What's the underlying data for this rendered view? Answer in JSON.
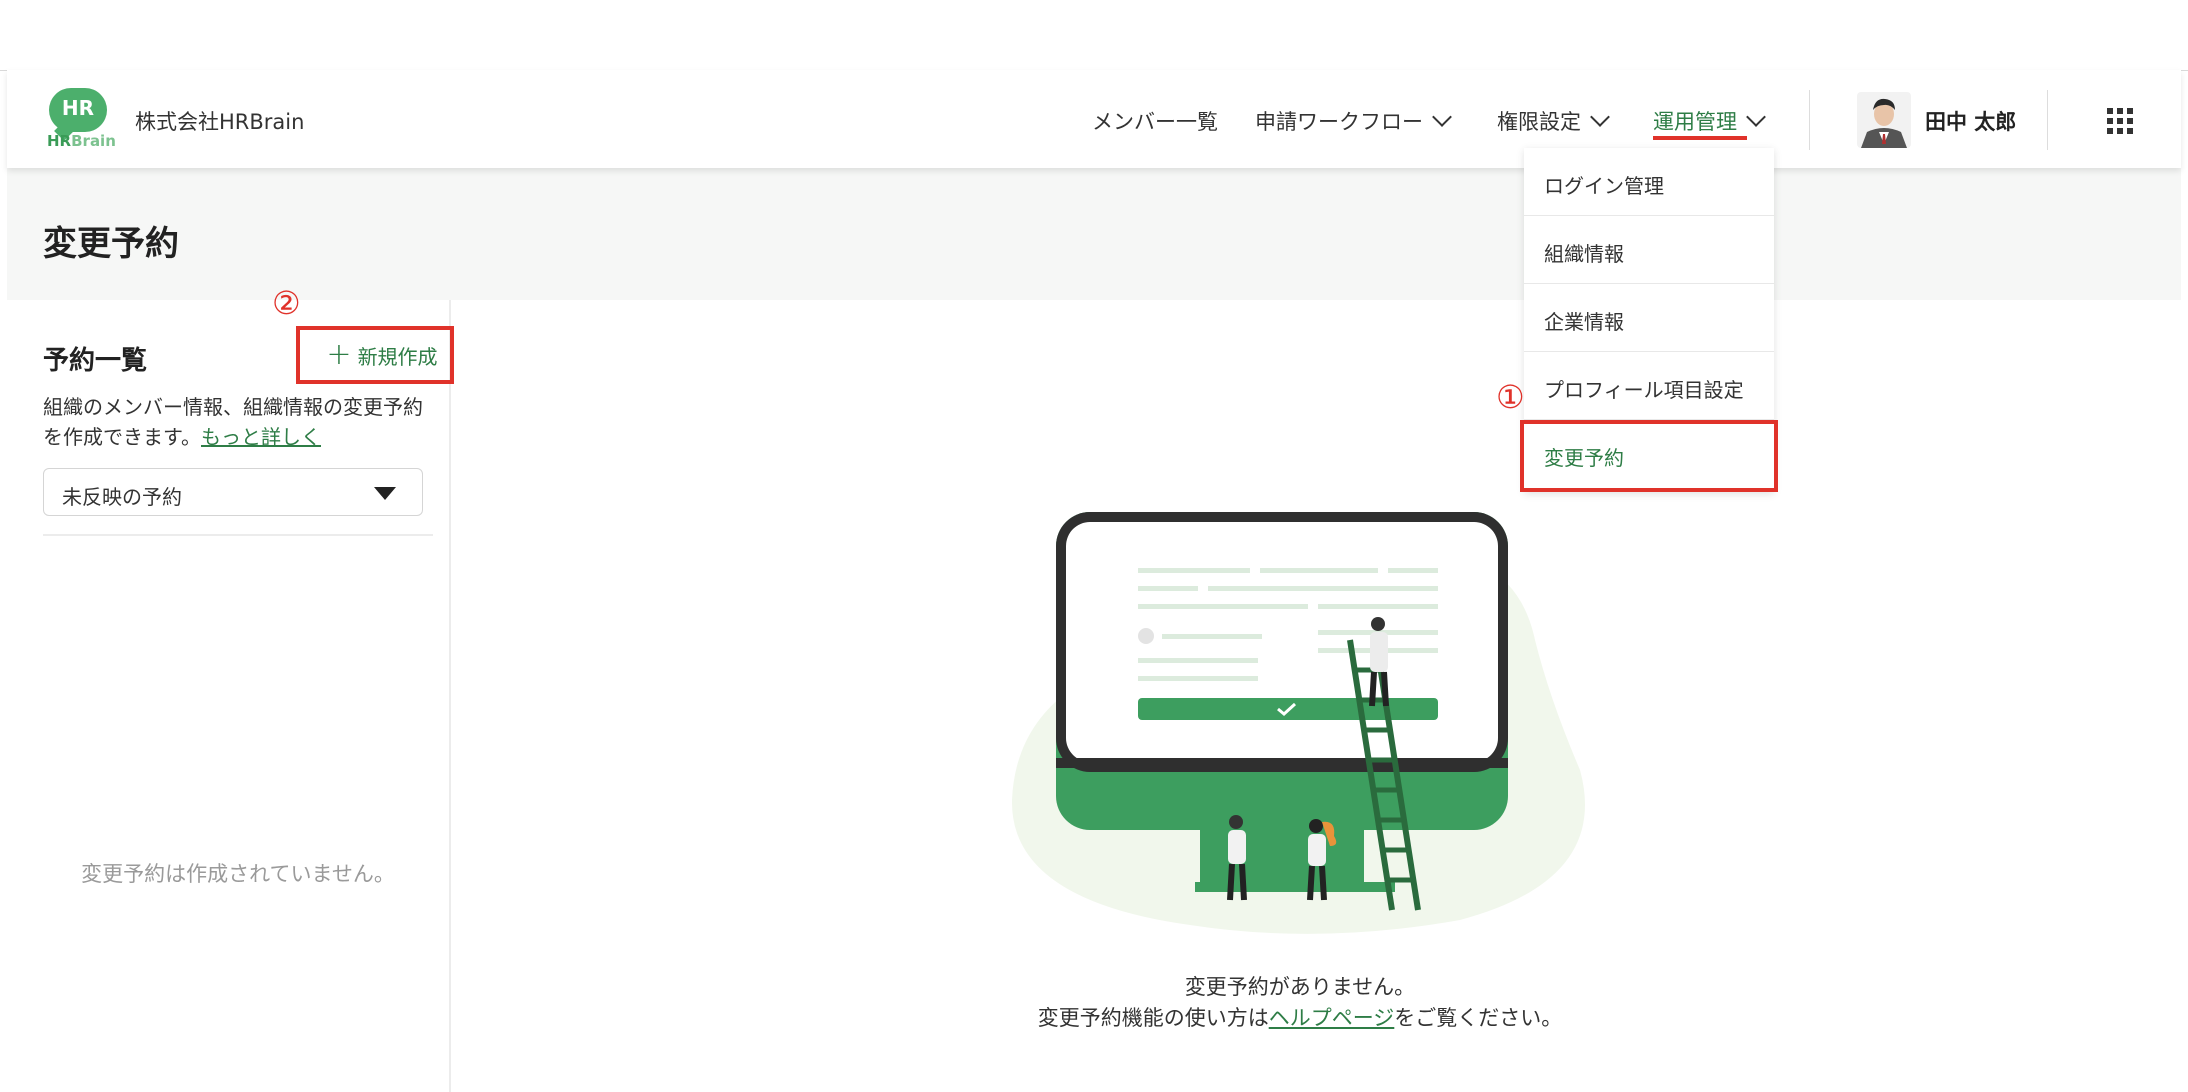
{
  "header": {
    "logo_badge": "HR",
    "logo_text_hr": "HR",
    "logo_text_brain": "Brain",
    "company": "株式会社HRBrain",
    "nav": {
      "members": "メンバー一覧",
      "workflow": "申請ワークフロー",
      "permissions": "権限設定",
      "operations": "運用管理"
    },
    "user_name": "田中 太郎"
  },
  "dropdown": {
    "items": [
      "ログイン管理",
      "組織情報",
      "企業情報",
      "プロフィール項目設定",
      "変更予約"
    ],
    "active_index": 4
  },
  "page": {
    "title": "変更予約"
  },
  "left_panel": {
    "list_title": "予約一覧",
    "new_button": "新規作成",
    "desc": "組織のメンバー情報、組織情報の変更予約を作成できます。",
    "desc_link": "もっと詳しく",
    "select_value": "未反映の予約",
    "empty_text": "変更予約は作成されていません。"
  },
  "main": {
    "empty_line1": "変更予約がありません。",
    "empty_line2_pre": "変更予約機能の使い方は",
    "empty_line2_link": "ヘルプページ",
    "empty_line2_post": "をご覧ください。"
  },
  "annotations": {
    "marker_1": "①",
    "marker_2": "②"
  },
  "colors": {
    "brand_green": "#2e7d46",
    "logo_green": "#4caf6c",
    "annotation_red": "#e0322a"
  }
}
